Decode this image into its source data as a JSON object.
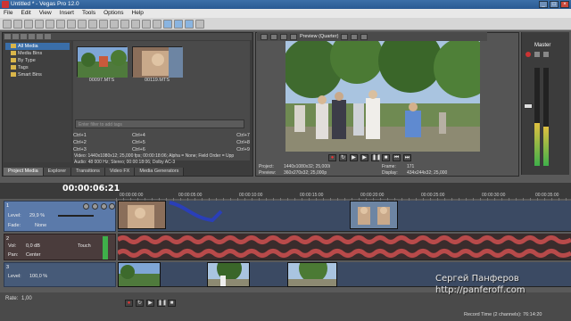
{
  "window": {
    "title": "Untitled * - Vegas Pro 12.0"
  },
  "menu": [
    "File",
    "Edit",
    "View",
    "Insert",
    "Tools",
    "Options",
    "Help"
  ],
  "project_media": {
    "tree": [
      "All Media",
      "Media Bins",
      "By Type",
      "Tags",
      "Smart Bins"
    ],
    "thumbnails": [
      "00097.MTS",
      "00119.MTS"
    ],
    "search_placeholder": "Enter filter to add tags",
    "channels": [
      [
        "Ctrl+1",
        "Ctrl+4",
        "Ctrl+7"
      ],
      [
        "Ctrl+2",
        "Ctrl+5",
        "Ctrl+8"
      ],
      [
        "Ctrl+3",
        "Ctrl+6",
        "Ctrl+9"
      ]
    ],
    "info_video": "Video: 1440x1080x12; 25,000 fps; 00:00:18:06; Alpha = None; Field Order = Upp",
    "info_audio": "Audio: 48 000 Hz; Stereo; 00:00:18:06; Dolby AC-3"
  },
  "tabs": [
    "Project Media",
    "Explorer",
    "Transitions",
    "Video FX",
    "Media Generators"
  ],
  "preview": {
    "mode": "Preview (Quarter)",
    "project_label": "Project:",
    "project_value": "1440x1080x32; 25,000i",
    "preview_label": "Preview:",
    "preview_value": "360x270x32; 25,000p",
    "frame_label": "Frame:",
    "frame_value": "171",
    "display_label": "Display:",
    "display_value": "434x244x32; 25,000"
  },
  "master": {
    "label": "Master"
  },
  "timeline": {
    "current_time": "00:00:06:21",
    "ruler": [
      "00:00:00:00",
      "00:00:05:00",
      "00:00:10:00",
      "00:00:15:00",
      "00:00:20:00",
      "00:00:25:00",
      "00:00:30:00",
      "00:00:35:00"
    ],
    "video_track_1": {
      "level_label": "Level:",
      "level_value": "29,9 %",
      "fade_label": "Fade:",
      "fade_value": "None"
    },
    "audio_track": {
      "vol_label": "Vol:",
      "vol_value": "0,0 dB",
      "pan_label": "Pan:",
      "pan_value": "Center",
      "mode": "Touch"
    },
    "video_track_2": {
      "level_label": "Level:",
      "level_value": "100,0 %"
    }
  },
  "status": {
    "rate_label": "Rate:",
    "rate_value": "1,00",
    "record_time": "Record Time (2 channels): 76:14:20"
  },
  "watermark": {
    "line1": "Сергей Панферов",
    "line2": "http://panferoff.com"
  }
}
